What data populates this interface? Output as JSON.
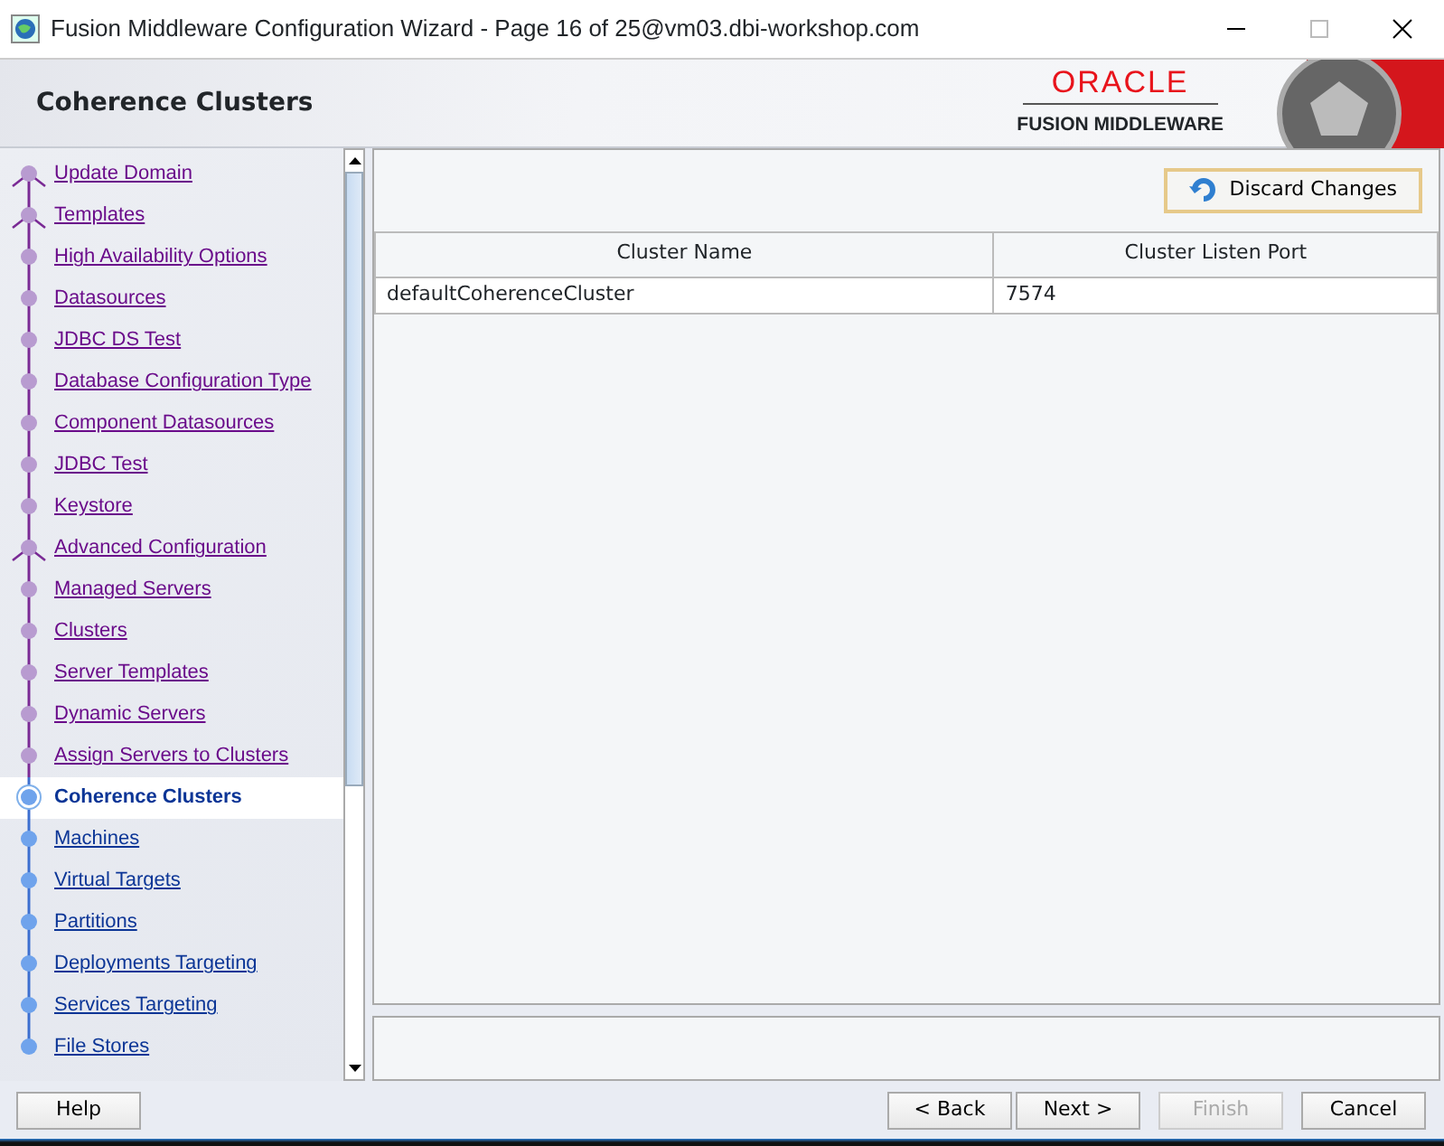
{
  "window": {
    "title": "Fusion Middleware Configuration Wizard - Page 16 of 25@vm03.dbi-workshop.com"
  },
  "header": {
    "title": "Coherence Clusters",
    "logo_top": "ORACLE",
    "logo_bottom": "FUSION MIDDLEWARE"
  },
  "steps": [
    {
      "label": "Update Domain",
      "visited": true,
      "selected": false,
      "branch": true
    },
    {
      "label": "Templates",
      "visited": true,
      "selected": false,
      "branch": true
    },
    {
      "label": "High Availability Options",
      "visited": true,
      "selected": false,
      "branch": false
    },
    {
      "label": "Datasources",
      "visited": true,
      "selected": false,
      "branch": false
    },
    {
      "label": "JDBC DS Test",
      "visited": true,
      "selected": false,
      "branch": false
    },
    {
      "label": "Database Configuration Type",
      "visited": true,
      "selected": false,
      "branch": false
    },
    {
      "label": "Component Datasources",
      "visited": true,
      "selected": false,
      "branch": false
    },
    {
      "label": "JDBC Test",
      "visited": true,
      "selected": false,
      "branch": false
    },
    {
      "label": "Keystore",
      "visited": true,
      "selected": false,
      "branch": false
    },
    {
      "label": "Advanced Configuration",
      "visited": true,
      "selected": false,
      "branch": true
    },
    {
      "label": "Managed Servers",
      "visited": true,
      "selected": false,
      "branch": false
    },
    {
      "label": "Clusters",
      "visited": true,
      "selected": false,
      "branch": false
    },
    {
      "label": "Server Templates",
      "visited": true,
      "selected": false,
      "branch": false
    },
    {
      "label": "Dynamic Servers",
      "visited": true,
      "selected": false,
      "branch": false
    },
    {
      "label": "Assign Servers to Clusters",
      "visited": true,
      "selected": false,
      "branch": false
    },
    {
      "label": "Coherence Clusters",
      "visited": false,
      "selected": true,
      "branch": false
    },
    {
      "label": "Machines",
      "visited": false,
      "selected": false,
      "branch": false
    },
    {
      "label": "Virtual Targets",
      "visited": false,
      "selected": false,
      "branch": false
    },
    {
      "label": "Partitions",
      "visited": false,
      "selected": false,
      "branch": false
    },
    {
      "label": "Deployments Targeting",
      "visited": false,
      "selected": false,
      "branch": false
    },
    {
      "label": "Services Targeting",
      "visited": false,
      "selected": false,
      "branch": false
    },
    {
      "label": "File Stores",
      "visited": false,
      "selected": false,
      "branch": false
    }
  ],
  "discard_button": "Discard Changes",
  "table": {
    "columns": [
      "Cluster Name",
      "Cluster Listen Port"
    ],
    "rows": [
      [
        "defaultCoherenceCluster",
        "7574"
      ]
    ]
  },
  "buttons": [
    {
      "label": "Help",
      "disabled": false
    },
    {
      "label": "< Back",
      "disabled": false
    },
    {
      "label": "Next >",
      "disabled": false
    },
    {
      "label": "Finish",
      "disabled": true
    },
    {
      "label": "Cancel",
      "disabled": false
    }
  ]
}
